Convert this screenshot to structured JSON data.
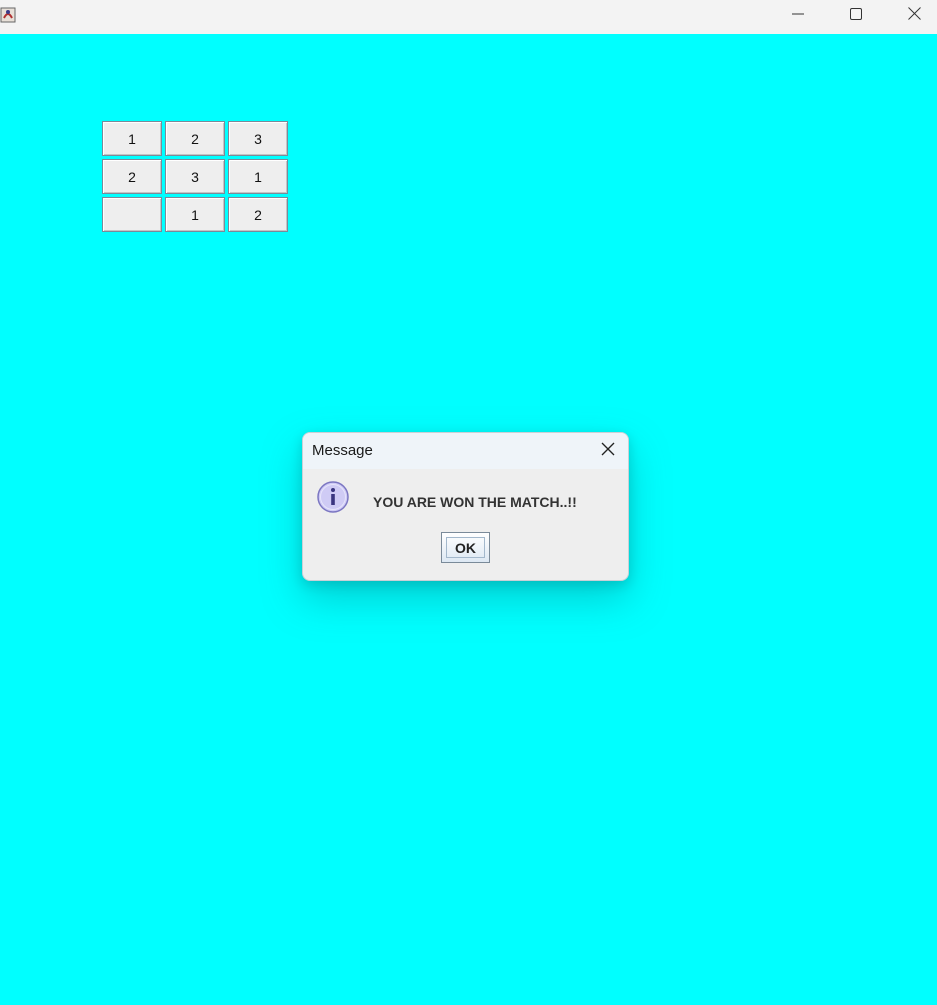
{
  "window": {
    "background": "#00ffff",
    "icons": {
      "app": "java-app-icon",
      "minimize": "minimize-icon",
      "maximize": "maximize-icon",
      "close": "close-icon"
    }
  },
  "board": {
    "rows": [
      [
        "1",
        "2",
        "3"
      ],
      [
        "2",
        "3",
        "1"
      ],
      [
        "",
        "1",
        "2"
      ]
    ]
  },
  "dialog": {
    "title": "Message",
    "message": "YOU ARE WON THE MATCH..!!",
    "ok_label": "OK",
    "icon": "info-icon",
    "close_icon": "close-icon"
  }
}
